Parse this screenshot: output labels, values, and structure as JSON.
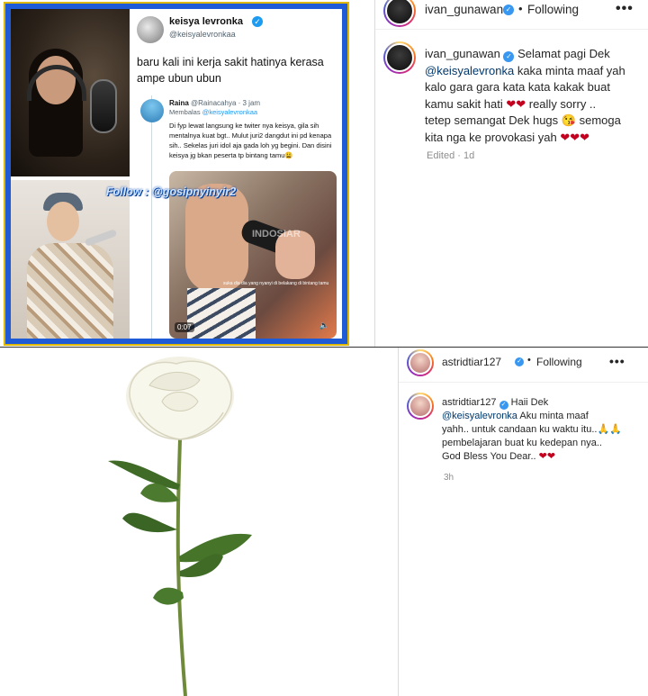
{
  "tweet": {
    "name": "keisya levronka",
    "handle": "@keisyalevronkaa",
    "text": "baru kali ini kerja sakit hatinya kerasa ampe ubun ubun",
    "reply": {
      "name": "Raina",
      "handle_time": "@Rainacahya · 3 jam",
      "replying_to_prefix": "Membalas",
      "replying_to": "@keisyalevronkaa",
      "text": "Di fyp lewat langsung ke twiter nya keisya, gila sih mentalnya kuat bgt.. Mulut juri2 dangdut ini pd kenapa sih.. Sekelas juri idol aja gada loh yg begini. Dan disini keisya jg bkan peserta tp bintang tamu😩"
    },
    "video": {
      "logo": "INDOSIAR",
      "caption": "suka dia dia yang nyanyi di belakang di bintang tamu",
      "time": "0:07",
      "volume_icon": "🔈"
    }
  },
  "watermark": "Follow : @gosipnyinyir2",
  "post_ivan": {
    "username": "ivan_gunawan",
    "follow_label": "Following",
    "more_label": "•••",
    "caption_username": "ivan_gunawan",
    "caption_l1": "Selamat pagi Dek",
    "mention": "@keisyalevronka",
    "caption_l2": "kaka minta maaf yah",
    "caption_l3": "kalo gara gara kata kata kakak buat",
    "caption_l4a": "kamu sakit hati",
    "caption_l4hearts": "❤❤",
    "caption_l4b": "really sorry ..",
    "caption_l5a": "tetep semangat Dek hugs",
    "caption_l5emoji": "😘",
    "caption_l5b": "semoga",
    "caption_l6": "kita nga ke provokasi yah",
    "caption_l6hearts": "❤❤❤",
    "meta": "Edited · 1d"
  },
  "post_astrid": {
    "username": "astridtiar127",
    "follow_label": "Following",
    "more_label": "•••",
    "caption_username": "astridtiar127",
    "caption_l1": "Haii Dek",
    "mention": "@keisyalevronka",
    "caption_l2": "Aku minta maaf",
    "caption_l3": "yahh.. untuk candaan ku waktu itu..🙏🙏",
    "caption_l4": "pembelajaran buat ku kedepan nya..",
    "caption_l5": "God Bless You Dear..",
    "caption_l5hearts": "❤❤",
    "meta": "3h"
  },
  "colors": {
    "frame_blue": "#1f5bd6",
    "frame_gold": "#e0b800",
    "ig_verified": "#3897f0",
    "mention": "#00376b",
    "heart": "#c4001f"
  }
}
